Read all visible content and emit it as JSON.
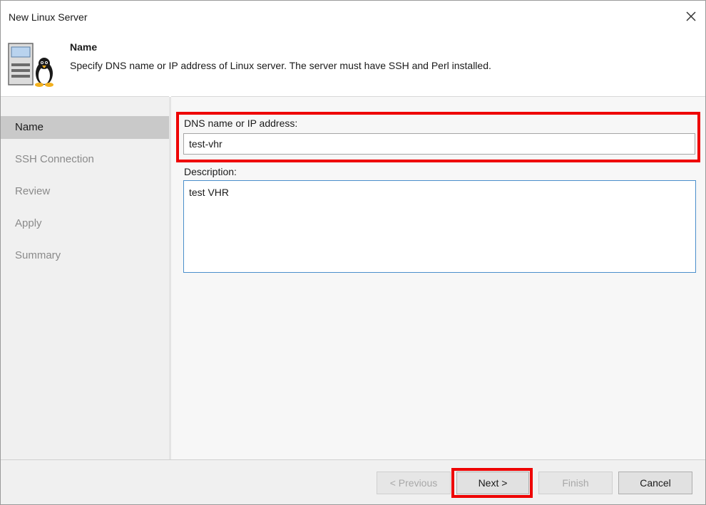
{
  "window": {
    "title": "New Linux Server"
  },
  "header": {
    "title": "Name",
    "description": "Specify DNS name or IP address of Linux server. The server must have SSH and Perl installed.",
    "icon": "linux-server-icon"
  },
  "steps": [
    {
      "label": "Name",
      "active": true
    },
    {
      "label": "SSH Connection",
      "active": false
    },
    {
      "label": "Review",
      "active": false
    },
    {
      "label": "Apply",
      "active": false
    },
    {
      "label": "Summary",
      "active": false
    }
  ],
  "form": {
    "dns": {
      "label": "DNS name or IP address:",
      "value": "test-vhr"
    },
    "description": {
      "label": "Description:",
      "value": "test VHR"
    }
  },
  "footer": {
    "previous_label": "< Previous",
    "next_label": "Next >",
    "finish_label": "Finish",
    "cancel_label": "Cancel"
  },
  "colors": {
    "highlight": "#ee0000",
    "active_step": "#c9c9c9",
    "sidebar": "#f0f0f0",
    "focus_border": "#4a8fcb"
  }
}
